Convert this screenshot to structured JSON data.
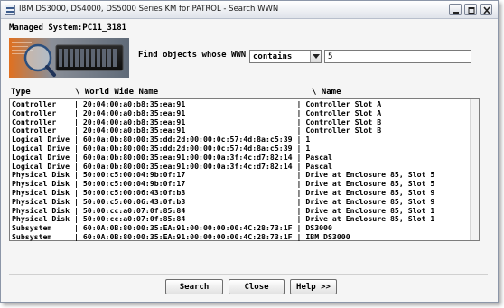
{
  "window": {
    "title": "IBM DS3000, DS4000, DS5000 Series KM for PATROL - Search WWN"
  },
  "managed_system": {
    "label": "Managed System:",
    "value": "PC11_3181"
  },
  "find": {
    "label": "Find objects whose WWN",
    "operator": "contains",
    "value": "5"
  },
  "columns": {
    "type": "Type",
    "wwn": "\\ World Wide Name",
    "name": "\\ Name"
  },
  "rows": [
    {
      "type": "Controller",
      "wwn": "20:04:00:a0:b8:35:ea:91",
      "name": "Controller Slot A"
    },
    {
      "type": "Controller",
      "wwn": "20:04:00:a0:b8:35:ea:91",
      "name": "Controller Slot A"
    },
    {
      "type": "Controller",
      "wwn": "20:04:00:a0:b8:35:ea:91",
      "name": "Controller Slot B"
    },
    {
      "type": "Controller",
      "wwn": "20:04:00:a0:b8:35:ea:91",
      "name": "Controller Slot B"
    },
    {
      "type": "Logical Drive",
      "wwn": "60:0a:0b:80:00:35:dd:2d:00:00:0c:57:4d:8a:c5:39",
      "name": "1"
    },
    {
      "type": "Logical Drive",
      "wwn": "60:0a:0b:80:00:35:dd:2d:00:00:0c:57:4d:8a:c5:39",
      "name": "1"
    },
    {
      "type": "Logical Drive",
      "wwn": "60:0a:0b:80:00:35:ea:91:00:00:0a:3f:4c:d7:82:14",
      "name": "Pascal"
    },
    {
      "type": "Logical Drive",
      "wwn": "60:0a:0b:80:00:35:ea:91:00:00:0a:3f:4c:d7:82:14",
      "name": "Pascal"
    },
    {
      "type": "Physical Disk",
      "wwn": "50:00:c5:00:04:9b:0f:17",
      "name": "Drive at Enclosure 85, Slot 5"
    },
    {
      "type": "Physical Disk",
      "wwn": "50:00:c5:00:04:9b:0f:17",
      "name": "Drive at Enclosure 85, Slot 5"
    },
    {
      "type": "Physical Disk",
      "wwn": "50:00:c5:00:06:43:0f:b3",
      "name": "Drive at Enclosure 85, Slot 9"
    },
    {
      "type": "Physical Disk",
      "wwn": "50:00:c5:00:06:43:0f:b3",
      "name": "Drive at Enclosure 85, Slot 9"
    },
    {
      "type": "Physical Disk",
      "wwn": "50:00:cc:a0:07:0f:85:84",
      "name": "Drive at Enclosure 85, Slot 1"
    },
    {
      "type": "Physical Disk",
      "wwn": "50:00:cc:a0:07:0f:85:84",
      "name": "Drive at Enclosure 85, Slot 1"
    },
    {
      "type": "Subsystem",
      "wwn": "60:0A:0B:80:00:35:EA:91:00:00:00:00:4C:28:73:1F",
      "name": "DS3000"
    },
    {
      "type": "Subsystem",
      "wwn": "60:0A:0B:80:00:35:EA:91:00:00:00:00:4C:28:73:1F",
      "name": "IBM DS3000"
    }
  ],
  "buttons": {
    "search": "Search",
    "close": "Close",
    "help": "Help >>"
  },
  "icons": {
    "app": "app-icon",
    "minimize": "minimize-icon",
    "maximize": "maximize-icon",
    "close": "close-icon",
    "dropdown": "chevron-down-icon"
  }
}
